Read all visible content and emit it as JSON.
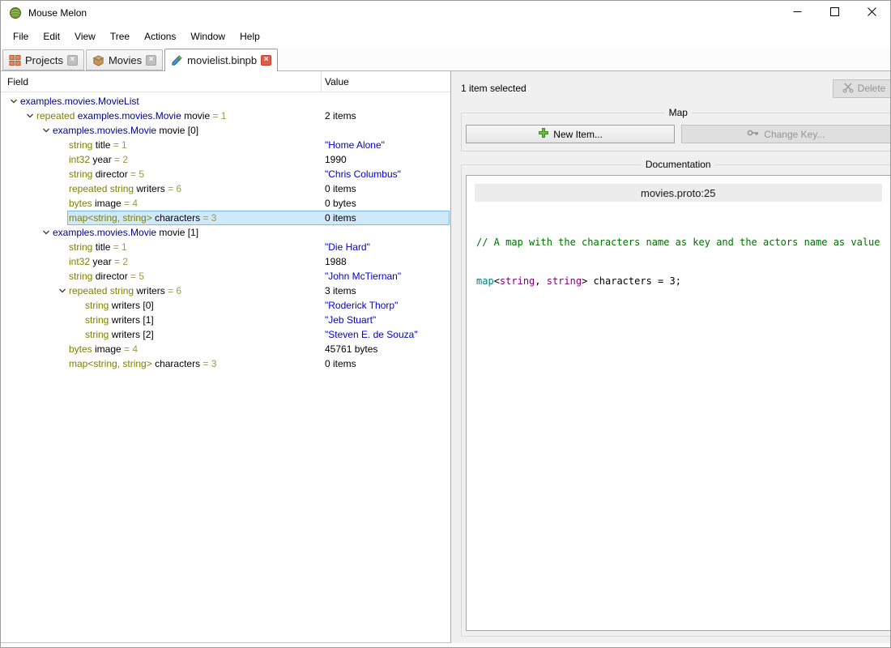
{
  "window": {
    "title": "Mouse Melon"
  },
  "menu": {
    "items": [
      "File",
      "Edit",
      "View",
      "Tree",
      "Actions",
      "Window",
      "Help"
    ]
  },
  "tabs": [
    {
      "label": "Projects",
      "icon": "blocks-icon",
      "active": false,
      "close": "gray"
    },
    {
      "label": "Movies",
      "icon": "package-icon",
      "active": false,
      "close": "gray"
    },
    {
      "label": "movielist.binpb",
      "icon": "proto-file-icon",
      "active": true,
      "close": "red"
    }
  ],
  "tree": {
    "columns": [
      "Field",
      "Value"
    ],
    "rows": [
      {
        "indent": 0,
        "expanded": true,
        "segments": [
          {
            "text": "examples.movies.MovieList",
            "color": "class"
          }
        ],
        "value": "",
        "value_color": "plain"
      },
      {
        "indent": 1,
        "expanded": true,
        "segments": [
          {
            "text": "repeated ",
            "color": "keyword"
          },
          {
            "text": "examples.movies.Movie ",
            "color": "class"
          },
          {
            "text": "movie ",
            "color": "name"
          },
          {
            "text": "= 1",
            "color": "fieldnum"
          }
        ],
        "value": "2 items",
        "value_color": "plain"
      },
      {
        "indent": 2,
        "expanded": true,
        "segments": [
          {
            "text": "examples.movies.Movie ",
            "color": "class"
          },
          {
            "text": "movie [0]",
            "color": "name"
          }
        ],
        "value": "",
        "value_color": "plain"
      },
      {
        "indent": 3,
        "segments": [
          {
            "text": "string ",
            "color": "keyword"
          },
          {
            "text": "title ",
            "color": "name"
          },
          {
            "text": "= 1",
            "color": "fieldnum"
          }
        ],
        "value": "\"Home Alone\"",
        "value_color": "string"
      },
      {
        "indent": 3,
        "segments": [
          {
            "text": "int32 ",
            "color": "keyword"
          },
          {
            "text": "year ",
            "color": "name"
          },
          {
            "text": "= 2",
            "color": "fieldnum"
          }
        ],
        "value": "1990",
        "value_color": "plain"
      },
      {
        "indent": 3,
        "segments": [
          {
            "text": "string ",
            "color": "keyword"
          },
          {
            "text": "director ",
            "color": "name"
          },
          {
            "text": "= 5",
            "color": "fieldnum"
          }
        ],
        "value": "\"Chris Columbus\"",
        "value_color": "string"
      },
      {
        "indent": 3,
        "segments": [
          {
            "text": "repeated string ",
            "color": "keyword"
          },
          {
            "text": "writers ",
            "color": "name"
          },
          {
            "text": "= 6",
            "color": "fieldnum"
          }
        ],
        "value": "0 items",
        "value_color": "plain"
      },
      {
        "indent": 3,
        "segments": [
          {
            "text": "bytes ",
            "color": "keyword"
          },
          {
            "text": "image ",
            "color": "name"
          },
          {
            "text": "= 4",
            "color": "fieldnum"
          }
        ],
        "value": "0 bytes",
        "value_color": "plain"
      },
      {
        "indent": 3,
        "selected": true,
        "segments": [
          {
            "text": "map<string, string> ",
            "color": "keyword"
          },
          {
            "text": "characters ",
            "color": "name"
          },
          {
            "text": "= 3",
            "color": "fieldnum"
          }
        ],
        "value": "0 items",
        "value_color": "plain"
      },
      {
        "indent": 2,
        "expanded": true,
        "segments": [
          {
            "text": "examples.movies.Movie ",
            "color": "class"
          },
          {
            "text": "movie [1]",
            "color": "name"
          }
        ],
        "value": "",
        "value_color": "plain"
      },
      {
        "indent": 3,
        "segments": [
          {
            "text": "string ",
            "color": "keyword"
          },
          {
            "text": "title ",
            "color": "name"
          },
          {
            "text": "= 1",
            "color": "fieldnum"
          }
        ],
        "value": "\"Die Hard\"",
        "value_color": "string"
      },
      {
        "indent": 3,
        "segments": [
          {
            "text": "int32 ",
            "color": "keyword"
          },
          {
            "text": "year ",
            "color": "name"
          },
          {
            "text": "= 2",
            "color": "fieldnum"
          }
        ],
        "value": "1988",
        "value_color": "plain"
      },
      {
        "indent": 3,
        "segments": [
          {
            "text": "string ",
            "color": "keyword"
          },
          {
            "text": "director ",
            "color": "name"
          },
          {
            "text": "= 5",
            "color": "fieldnum"
          }
        ],
        "value": "\"John McTiernan\"",
        "value_color": "string"
      },
      {
        "indent": 3,
        "expanded": true,
        "segments": [
          {
            "text": "repeated string ",
            "color": "keyword"
          },
          {
            "text": "writers ",
            "color": "name"
          },
          {
            "text": "= 6",
            "color": "fieldnum"
          }
        ],
        "value": "3 items",
        "value_color": "plain"
      },
      {
        "indent": 4,
        "segments": [
          {
            "text": "string ",
            "color": "keyword"
          },
          {
            "text": "writers [0]",
            "color": "name"
          }
        ],
        "value": "\"Roderick Thorp\"",
        "value_color": "string"
      },
      {
        "indent": 4,
        "segments": [
          {
            "text": "string ",
            "color": "keyword"
          },
          {
            "text": "writers [1]",
            "color": "name"
          }
        ],
        "value": "\"Jeb Stuart\"",
        "value_color": "string"
      },
      {
        "indent": 4,
        "segments": [
          {
            "text": "string ",
            "color": "keyword"
          },
          {
            "text": "writers [2]",
            "color": "name"
          }
        ],
        "value": "\"Steven E. de Souza\"",
        "value_color": "string"
      },
      {
        "indent": 3,
        "segments": [
          {
            "text": "bytes ",
            "color": "keyword"
          },
          {
            "text": "image ",
            "color": "name"
          },
          {
            "text": "= 4",
            "color": "fieldnum"
          }
        ],
        "value": "45761 bytes",
        "value_color": "plain"
      },
      {
        "indent": 3,
        "segments": [
          {
            "text": "map<string, string> ",
            "color": "keyword"
          },
          {
            "text": "characters ",
            "color": "name"
          },
          {
            "text": "= 3",
            "color": "fieldnum"
          }
        ],
        "value": "0 items",
        "value_color": "plain"
      }
    ]
  },
  "detail": {
    "selection_status": "1 item selected",
    "delete_label": "Delete",
    "delete_icon": "scissors-icon",
    "map_group": {
      "title": "Map",
      "new_item_label": "New Item...",
      "new_item_icon": "plus-icon",
      "change_key_label": "Change Key...",
      "change_key_icon": "key-icon"
    },
    "documentation": {
      "title": "Documentation",
      "header": "movies.proto:25",
      "comment": "// A map with the characters name as key and the actors name as value",
      "code_segments": [
        {
          "text": "map",
          "color": "#008080"
        },
        {
          "text": "<",
          "color": "#000000"
        },
        {
          "text": "string",
          "color": "#800080"
        },
        {
          "text": ", ",
          "color": "#000000"
        },
        {
          "text": "string",
          "color": "#800080"
        },
        {
          "text": ">",
          "color": "#000000"
        },
        {
          "text": " characters = 3;",
          "color": "#000000"
        }
      ]
    }
  },
  "colors": {
    "keyword": "#7f7f00",
    "class": "#000099",
    "name": "#000000",
    "fieldnum": "#99994d",
    "string_value": "#0000cc",
    "plain_value": "#000000",
    "comment": "#007000",
    "selection_bg": "#cfe9fa",
    "selection_border": "#7ab8e8"
  }
}
